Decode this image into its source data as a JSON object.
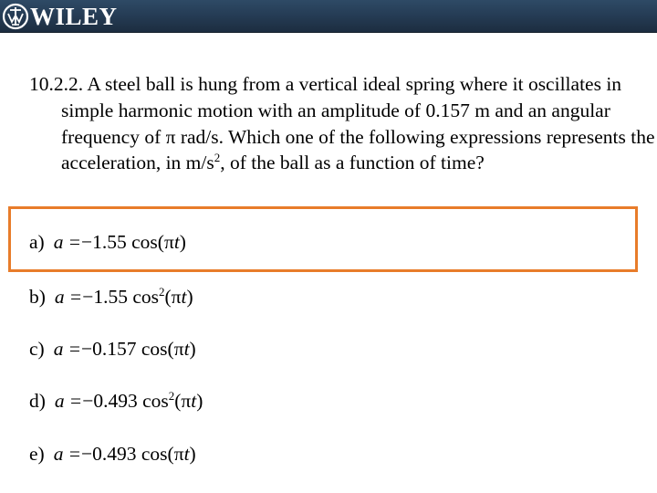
{
  "header": {
    "brand": "WILEY",
    "logo_icon": "wiley-logo-icon",
    "colors": {
      "bar_top": "#2e4a66",
      "bar_bottom": "#1c2d40"
    }
  },
  "question": {
    "number": "10.2.2.",
    "text_before_sup": "A steel ball is hung from a vertical ideal spring where it oscillates in simple harmonic motion with an amplitude of 0.157 m and an angular frequency of π rad/s.  Which one of the following expressions represents the acceleration, in m/s",
    "sup": "2",
    "text_after_sup": ", of the ball as a function of time?"
  },
  "highlight": {
    "color": "#e87c2a",
    "highlighted_option": "a"
  },
  "options": [
    {
      "label": "a)",
      "var": "a",
      "eq": "=",
      "coef": "−1.55",
      "fn": "cos",
      "power": "",
      "arg_open": "(",
      "pi": "π",
      "t": "t",
      "arg_close": ")"
    },
    {
      "label": "b)",
      "var": "a",
      "eq": "=",
      "coef": "−1.55",
      "fn": "cos",
      "power": "2",
      "arg_open": "(",
      "pi": "π",
      "t": "t",
      "arg_close": ")"
    },
    {
      "label": "c)",
      "var": "a",
      "eq": "=",
      "coef": "−0.157",
      "fn": "cos",
      "power": "",
      "arg_open": "(",
      "pi": "π",
      "t": "t",
      "arg_close": ")"
    },
    {
      "label": "d)",
      "var": "a",
      "eq": "=",
      "coef": "−0.493",
      "fn": "cos",
      "power": "2",
      "arg_open": "(",
      "pi": "π",
      "t": "t",
      "arg_close": ")"
    },
    {
      "label": "e)",
      "var": "a",
      "eq": "=",
      "coef": "−0.493",
      "fn": "cos",
      "power": "",
      "arg_open": "(",
      "pi": "π",
      "t": "t",
      "arg_close": ")"
    }
  ]
}
